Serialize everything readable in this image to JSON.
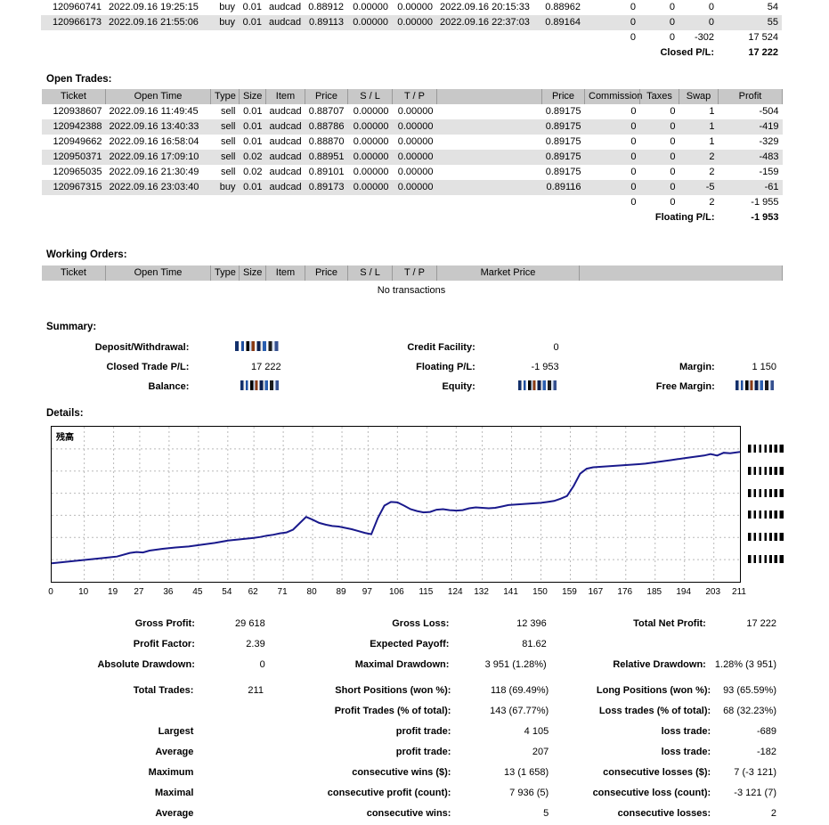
{
  "closed_tail": {
    "rows": [
      {
        "ticket": "120960741",
        "open_time": "2022.09.16 19:25:15",
        "type": "buy",
        "size": "0.01",
        "item": "audcad",
        "price": "0.88912",
        "sl": "0.00000",
        "tp": "0.00000",
        "close_time": "2022.09.16 20:15:33",
        "close_price": "0.88962",
        "commission": "0",
        "taxes": "0",
        "swap": "0",
        "profit": "54"
      },
      {
        "ticket": "120966173",
        "open_time": "2022.09.16 21:55:06",
        "type": "buy",
        "size": "0.01",
        "item": "audcad",
        "price": "0.89113",
        "sl": "0.00000",
        "tp": "0.00000",
        "close_time": "2022.09.16 22:37:03",
        "close_price": "0.89164",
        "commission": "0",
        "taxes": "0",
        "swap": "0",
        "profit": "55"
      }
    ],
    "totals": {
      "commission": "0",
      "taxes": "0",
      "swap": "-302",
      "profit": "17 524"
    },
    "closed_pl_label": "Closed P/L:",
    "closed_pl_value": "17 222"
  },
  "open_trades": {
    "heading": "Open Trades:",
    "columns": [
      "Ticket",
      "Open Time",
      "Type",
      "Size",
      "Item",
      "Price",
      "S / L",
      "T / P",
      "",
      "Price",
      "Commission",
      "Taxes",
      "Swap",
      "Profit"
    ],
    "rows": [
      {
        "ticket": "120938607",
        "open_time": "2022.09.16 11:49:45",
        "type": "sell",
        "size": "0.01",
        "item": "audcad",
        "price": "0.88707",
        "sl": "0.00000",
        "tp": "0.00000",
        "mkt_price": "0.89175",
        "commission": "0",
        "taxes": "0",
        "swap": "1",
        "profit": "-504"
      },
      {
        "ticket": "120942388",
        "open_time": "2022.09.16 13:40:33",
        "type": "sell",
        "size": "0.01",
        "item": "audcad",
        "price": "0.88786",
        "sl": "0.00000",
        "tp": "0.00000",
        "mkt_price": "0.89175",
        "commission": "0",
        "taxes": "0",
        "swap": "1",
        "profit": "-419"
      },
      {
        "ticket": "120949662",
        "open_time": "2022.09.16 16:58:04",
        "type": "sell",
        "size": "0.01",
        "item": "audcad",
        "price": "0.88870",
        "sl": "0.00000",
        "tp": "0.00000",
        "mkt_price": "0.89175",
        "commission": "0",
        "taxes": "0",
        "swap": "1",
        "profit": "-329"
      },
      {
        "ticket": "120950371",
        "open_time": "2022.09.16 17:09:10",
        "type": "sell",
        "size": "0.02",
        "item": "audcad",
        "price": "0.88951",
        "sl": "0.00000",
        "tp": "0.00000",
        "mkt_price": "0.89175",
        "commission": "0",
        "taxes": "0",
        "swap": "2",
        "profit": "-483"
      },
      {
        "ticket": "120965035",
        "open_time": "2022.09.16 21:30:49",
        "type": "sell",
        "size": "0.02",
        "item": "audcad",
        "price": "0.89101",
        "sl": "0.00000",
        "tp": "0.00000",
        "mkt_price": "0.89175",
        "commission": "0",
        "taxes": "0",
        "swap": "2",
        "profit": "-159"
      },
      {
        "ticket": "120967315",
        "open_time": "2022.09.16 23:03:40",
        "type": "buy",
        "size": "0.01",
        "item": "audcad",
        "price": "0.89173",
        "sl": "0.00000",
        "tp": "0.00000",
        "mkt_price": "0.89116",
        "commission": "0",
        "taxes": "0",
        "swap": "-5",
        "profit": "-61"
      }
    ],
    "totals": {
      "commission": "0",
      "taxes": "0",
      "swap": "2",
      "profit": "-1 955"
    },
    "floating_pl_label": "Floating P/L:",
    "floating_pl_value": "-1 953"
  },
  "working_orders": {
    "heading": "Working Orders:",
    "columns": [
      "Ticket",
      "Open Time",
      "Type",
      "Size",
      "Item",
      "Price",
      "S / L",
      "T / P",
      "Market Price",
      ""
    ],
    "empty_text": "No transactions"
  },
  "summary": {
    "heading": "Summary:",
    "deposit_label": "Deposit/Withdrawal:",
    "deposit_value": "",
    "credit_label": "Credit Facility:",
    "credit_value": "0",
    "closed_trade_label": "Closed Trade P/L:",
    "closed_trade_value": "17 222",
    "floating_label": "Floating P/L:",
    "floating_value": "-1 953",
    "margin_label": "Margin:",
    "margin_value": "1 150",
    "balance_label": "Balance:",
    "balance_value": "",
    "equity_label": "Equity:",
    "equity_value": "",
    "free_margin_label": "Free Margin:",
    "free_margin_value": ""
  },
  "details": {
    "heading": "Details:"
  },
  "chart_data": {
    "type": "line",
    "title": "残高",
    "xlabel": "",
    "ylabel": "",
    "grid": true,
    "legend": false,
    "series_color": "#19198c",
    "xticks": [
      0,
      10,
      19,
      27,
      36,
      45,
      54,
      62,
      71,
      80,
      89,
      97,
      106,
      115,
      124,
      132,
      141,
      150,
      159,
      167,
      176,
      185,
      194,
      203,
      211
    ],
    "ytick_count": 6,
    "ytick_labels": [
      "",
      "",
      "",
      "",
      "",
      ""
    ],
    "xlim": [
      0,
      211
    ],
    "x": [
      0,
      4,
      8,
      12,
      16,
      20,
      24,
      26,
      28,
      30,
      34,
      38,
      42,
      46,
      50,
      54,
      58,
      62,
      64,
      66,
      68,
      70,
      72,
      74,
      76,
      78,
      80,
      82,
      84,
      86,
      88,
      90,
      92,
      94,
      96,
      98,
      100,
      102,
      104,
      106,
      108,
      110,
      112,
      114,
      116,
      118,
      120,
      122,
      124,
      126,
      128,
      130,
      132,
      134,
      136,
      138,
      140,
      142,
      144,
      146,
      148,
      150,
      152,
      154,
      156,
      158,
      160,
      162,
      164,
      166,
      168,
      170,
      172,
      174,
      176,
      178,
      180,
      182,
      184,
      186,
      188,
      190,
      192,
      194,
      196,
      198,
      200,
      202,
      204,
      206,
      208,
      211
    ],
    "y": [
      2800,
      3100,
      3400,
      3700,
      4000,
      4300,
      5100,
      5300,
      5200,
      5600,
      6000,
      6300,
      6500,
      6900,
      7300,
      7800,
      8100,
      8400,
      8600,
      8900,
      9100,
      9400,
      9600,
      10200,
      11600,
      13000,
      12400,
      11700,
      11300,
      11000,
      10900,
      10600,
      10300,
      9900,
      9500,
      9200,
      12800,
      15500,
      16300,
      16200,
      15500,
      14700,
      14300,
      14000,
      14100,
      14600,
      14700,
      14500,
      14400,
      14500,
      14900,
      15100,
      15000,
      14900,
      15000,
      15300,
      15600,
      15700,
      15800,
      15900,
      16000,
      16100,
      16300,
      16500,
      17000,
      17600,
      19800,
      22500,
      23600,
      23900,
      24000,
      24100,
      24200,
      24300,
      24400,
      24500,
      24600,
      24700,
      24900,
      25100,
      25300,
      25500,
      25700,
      25900,
      26100,
      26300,
      26500,
      26800,
      26500,
      27100,
      27000,
      27300
    ]
  },
  "stats": {
    "gross_profit_label": "Gross Profit:",
    "gross_profit_value": "29 618",
    "gross_loss_label": "Gross Loss:",
    "gross_loss_value": "12 396",
    "total_net_profit_label": "Total Net Profit:",
    "total_net_profit_value": "17 222",
    "profit_factor_label": "Profit Factor:",
    "profit_factor_value": "2.39",
    "expected_payoff_label": "Expected Payoff:",
    "expected_payoff_value": "81.62",
    "absolute_drawdown_label": "Absolute Drawdown:",
    "absolute_drawdown_value": "0",
    "maximal_drawdown_label": "Maximal Drawdown:",
    "maximal_drawdown_value": "3 951 (1.28%)",
    "relative_drawdown_label": "Relative Drawdown:",
    "relative_drawdown_value": "1.28% (3 951)",
    "total_trades_label": "Total Trades:",
    "total_trades_value": "211",
    "short_positions_label": "Short Positions (won %):",
    "short_positions_value": "118 (69.49%)",
    "long_positions_label": "Long Positions (won %):",
    "long_positions_value": "93 (65.59%)",
    "profit_trades_label": "Profit Trades (% of total):",
    "profit_trades_value": "143 (67.77%)",
    "loss_trades_label": "Loss trades (% of total):",
    "loss_trades_value": "68 (32.23%)",
    "largest_label": "Largest",
    "largest_profit_label": "profit trade:",
    "largest_profit_value": "4 105",
    "largest_loss_label": "loss trade:",
    "largest_loss_value": "-689",
    "average_label": "Average",
    "average_profit_label": "profit trade:",
    "average_profit_value": "207",
    "average_loss_label": "loss trade:",
    "average_loss_value": "-182",
    "maximum_label": "Maximum",
    "max_cons_wins_label": "consecutive wins ($):",
    "max_cons_wins_value": "13 (1 658)",
    "max_cons_losses_label": "consecutive losses ($):",
    "max_cons_losses_value": "7 (-3 121)",
    "maximal_label": "Maximal",
    "maximal_cons_profit_label": "consecutive profit (count):",
    "maximal_cons_profit_value": "7 936 (5)",
    "maximal_cons_loss_label": "consecutive loss (count):",
    "maximal_cons_loss_value": "-3 121 (7)",
    "average2_label": "Average",
    "avg_cons_wins_label": "consecutive wins:",
    "avg_cons_wins_value": "5",
    "avg_cons_losses_label": "consecutive losses:",
    "avg_cons_losses_value": "2"
  }
}
